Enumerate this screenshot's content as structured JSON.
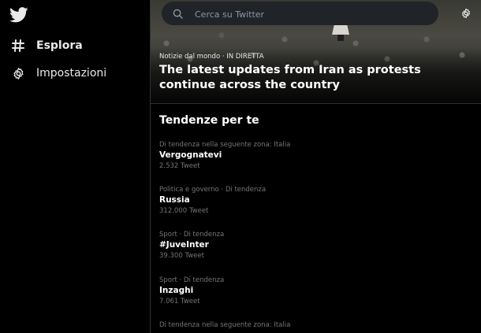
{
  "sidebar": {
    "logo_icon": "twitter-bird-icon",
    "items": [
      {
        "label": "Esplora",
        "icon": "hashtag-icon"
      },
      {
        "label": "Impostazioni",
        "icon": "gear-icon"
      }
    ]
  },
  "search": {
    "placeholder": "Cerca su Twitter",
    "value": ""
  },
  "header": {
    "settings_icon": "gear-icon"
  },
  "hero": {
    "meta": "Notizie dal mondo · IN DIRETTA",
    "title": "The latest updates from Iran as protests continue across the country"
  },
  "trends_section": {
    "title": "Tendenze per te",
    "items": [
      {
        "context": "Di tendenza nella seguente zona: Italia",
        "name": "Vergognatevi",
        "count": "2.532 Tweet"
      },
      {
        "context": "Politica e governo · Di tendenza",
        "name": "Russia",
        "count": "312.000 Tweet"
      },
      {
        "context": "Sport · Di tendenza",
        "name": "#JuveInter",
        "count": "39.300 Tweet"
      },
      {
        "context": "Sport · Di tendenza",
        "name": "Inzaghi",
        "count": "7.061 Tweet"
      },
      {
        "context": "Di tendenza nella seguente zona: Italia",
        "name": "",
        "count": ""
      }
    ]
  },
  "colors": {
    "background": "#000000",
    "text": "#e7e9ea",
    "secondary_text": "#71767b",
    "search_bg": "#202327",
    "divider": "#2f3336"
  }
}
